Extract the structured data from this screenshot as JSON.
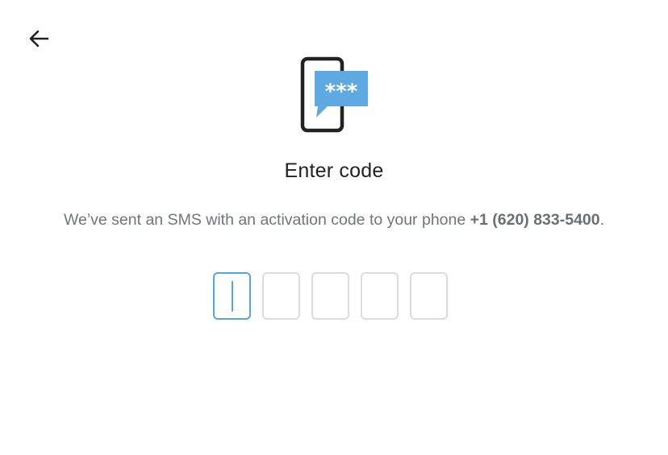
{
  "header": {
    "back_icon": "arrow-left-icon"
  },
  "illustration": {
    "icon": "phone-sms-code-icon",
    "bubble_text": "***",
    "bubble_color": "#5ea9e2",
    "phone_color": "#222222"
  },
  "title": "Enter code",
  "subtitle": {
    "text": "We’ve sent an SMS with an activation code to your phone ",
    "phone": "+1 (620) 833-5400",
    "end": "."
  },
  "code_input": {
    "length": 5,
    "digits": [
      "",
      "",
      "",
      "",
      ""
    ],
    "active_index": 0,
    "active_color": "#55a5e0",
    "border_color": "#dcdcdc"
  }
}
